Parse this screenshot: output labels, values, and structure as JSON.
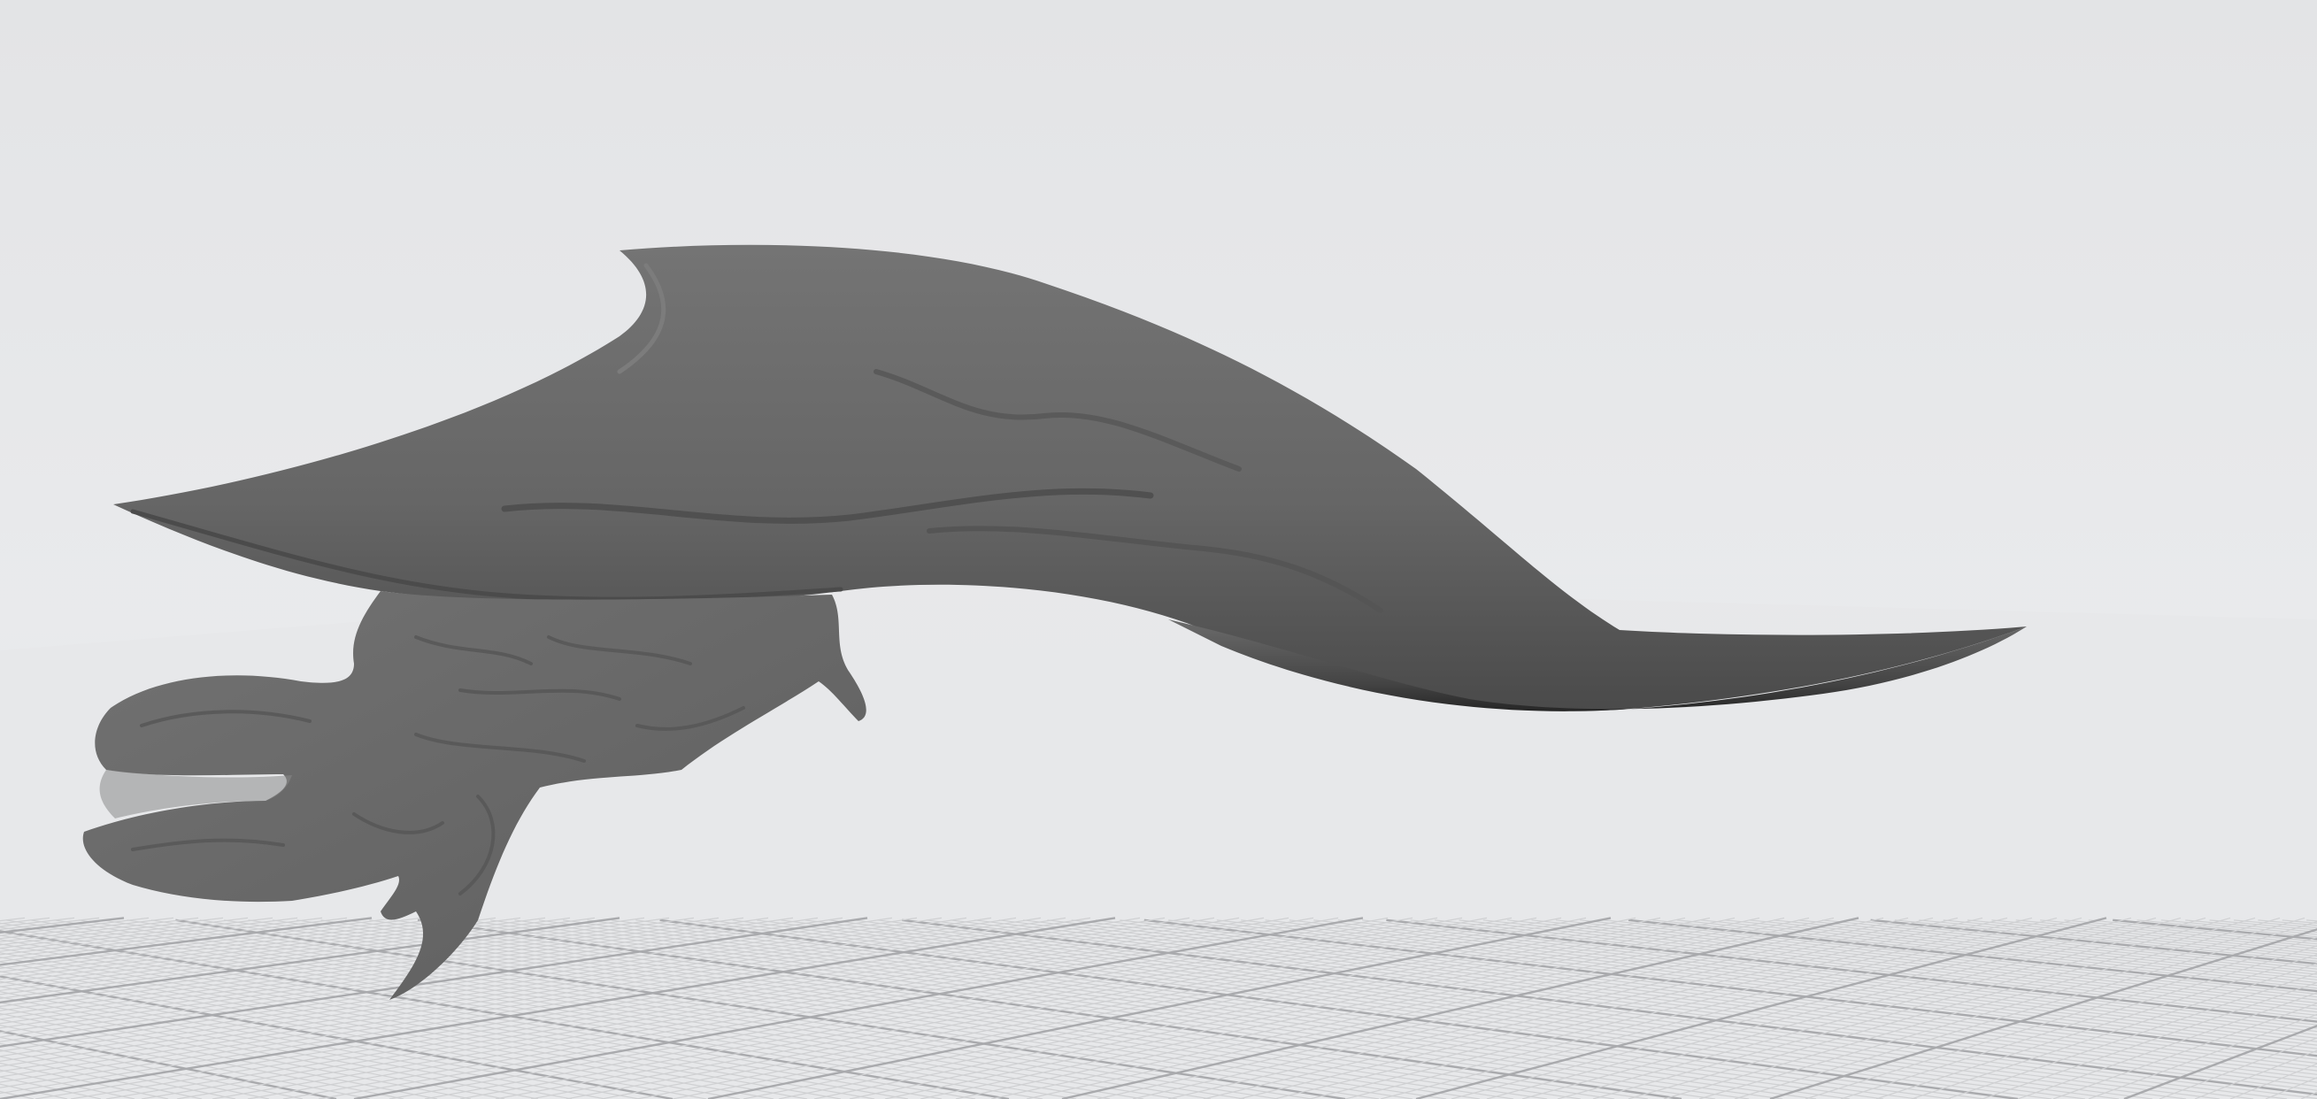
{
  "viewport": {
    "background_color": "#e6e7e9",
    "grid_minor_color": "#cfd0d2",
    "grid_major_color": "#a9aaad",
    "grid_visible": true
  },
  "model": {
    "icon": "sculpted-creature-mesh",
    "material_color": "#6a6a6a",
    "shadow_color": "#2f2f2f",
    "highlight_color": "#7a7a7a"
  }
}
